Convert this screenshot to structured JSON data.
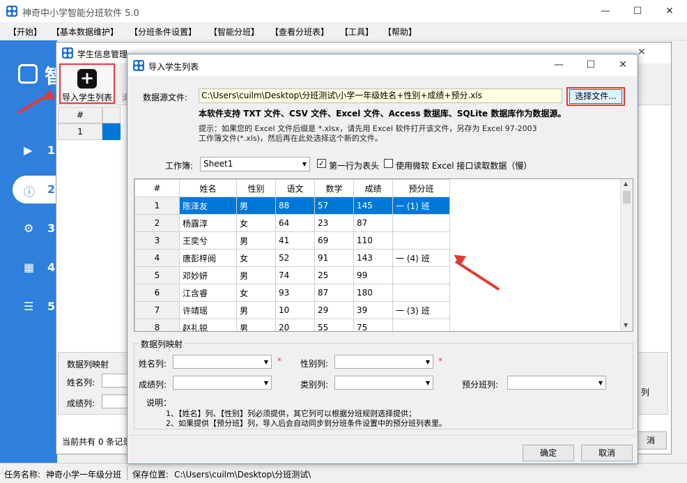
{
  "main_window": {
    "title": "神奇中小学智能分班软件 5.0",
    "controls": {
      "minimize": "—",
      "maximize": "☐",
      "close": "✕"
    },
    "menu": [
      "【开始】",
      "【基本数据维护】",
      "【分班条件设置】",
      "【智能分班】",
      "【查看分班表】",
      "【工具】",
      "【帮助】"
    ],
    "sidebar": {
      "logo_text": "智",
      "items": [
        {
          "icon": "play-circle-icon",
          "num": "1"
        },
        {
          "icon": "info-circle-icon",
          "num": "2"
        },
        {
          "icon": "gear-icon",
          "num": "3"
        },
        {
          "icon": "table-icon",
          "num": "4"
        },
        {
          "icon": "search-list-icon",
          "num": "5"
        }
      ]
    },
    "status": {
      "task_label": "任务名称:",
      "task_value": "神奇小学一年级分班",
      "save_label": "保存位置:",
      "save_value": "C:\\Users\\cuilm\\Desktop\\分班测试\\"
    }
  },
  "info_window": {
    "title": "学生信息管理",
    "import_button": "导入学生列表",
    "truncated_next": "清",
    "grid_header": "#",
    "grid_row_index": "1",
    "mapping_group": "数据列映射",
    "name_label": "姓名列:",
    "score_label": "成绩列:",
    "count_text": "当前共有 0 条记录",
    "right_text": "列",
    "right_btn": "消"
  },
  "dialog": {
    "title": "导入学生列表",
    "controls": {
      "minimize": "—",
      "maximize": "☐",
      "close": "✕"
    },
    "source_label": "数据源文件:",
    "source_path": "C:\\Users\\cuilm\\Desktop\\分班测试\\小学一年级姓名+性别+成绩+预分.xls",
    "choose_button": "选择文件...",
    "support_text": "本软件支持 TXT 文件、CSV 文件、Excel 文件、Access 数据库、SQLite 数据库作为数据源。",
    "hint_line1": "提示：如果您的 Excel 文件后缀是 *.xlsx，请先用 Excel 软件打开该文件，另存为 Excel 97-2003",
    "hint_line2": "工作簿文件(*.xls)，然后再在此处选择这个新的文件。",
    "workbook_label": "工作簿:",
    "workbook_value": "Sheet1",
    "first_row_header": "第一行为表头",
    "first_row_checked": "✓",
    "use_ms_excel": "使用微软 Excel 接口读取数据（慢）",
    "table": {
      "columns": [
        "#",
        "姓名",
        "性别",
        "语文",
        "数学",
        "成绩",
        "预分班"
      ],
      "rows": [
        [
          "1",
          "陈泽友",
          "男",
          "88",
          "57",
          "145",
          "一 (1) 班"
        ],
        [
          "2",
          "杨露淳",
          "女",
          "64",
          "23",
          "87",
          ""
        ],
        [
          "3",
          "王奕兮",
          "男",
          "41",
          "69",
          "110",
          ""
        ],
        [
          "4",
          "唐彭梓阅",
          "女",
          "52",
          "91",
          "143",
          "一 (4) 班"
        ],
        [
          "5",
          "邓妙妍",
          "男",
          "74",
          "25",
          "99",
          ""
        ],
        [
          "6",
          "江含睿",
          "女",
          "93",
          "87",
          "180",
          ""
        ],
        [
          "7",
          "许靖瑶",
          "男",
          "10",
          "29",
          "39",
          "一 (3) 班"
        ],
        [
          "8",
          "赵礼锐",
          "男",
          "20",
          "55",
          "75",
          ""
        ]
      ]
    },
    "mapping": {
      "group_title": "数据列映射",
      "name_label": "姓名列:",
      "gender_label": "性别列:",
      "score_label": "成绩列:",
      "category_label": "类别列:",
      "preclass_label": "预分班列:",
      "required_mark": "*",
      "note_title": "说明：",
      "note_1": "1、【姓名】列、【性别】列必须提供，其它列可以根据分班规则选择提供；",
      "note_2": "2、如果提供【预分班】列，导入后会自动同步到分班条件设置中的预分班列表里。"
    },
    "ok_button": "确定",
    "cancel_button": "取消"
  },
  "colors": {
    "accent": "#2f7fdc",
    "highlight_red": "#e53935",
    "selection": "#0078d7"
  }
}
